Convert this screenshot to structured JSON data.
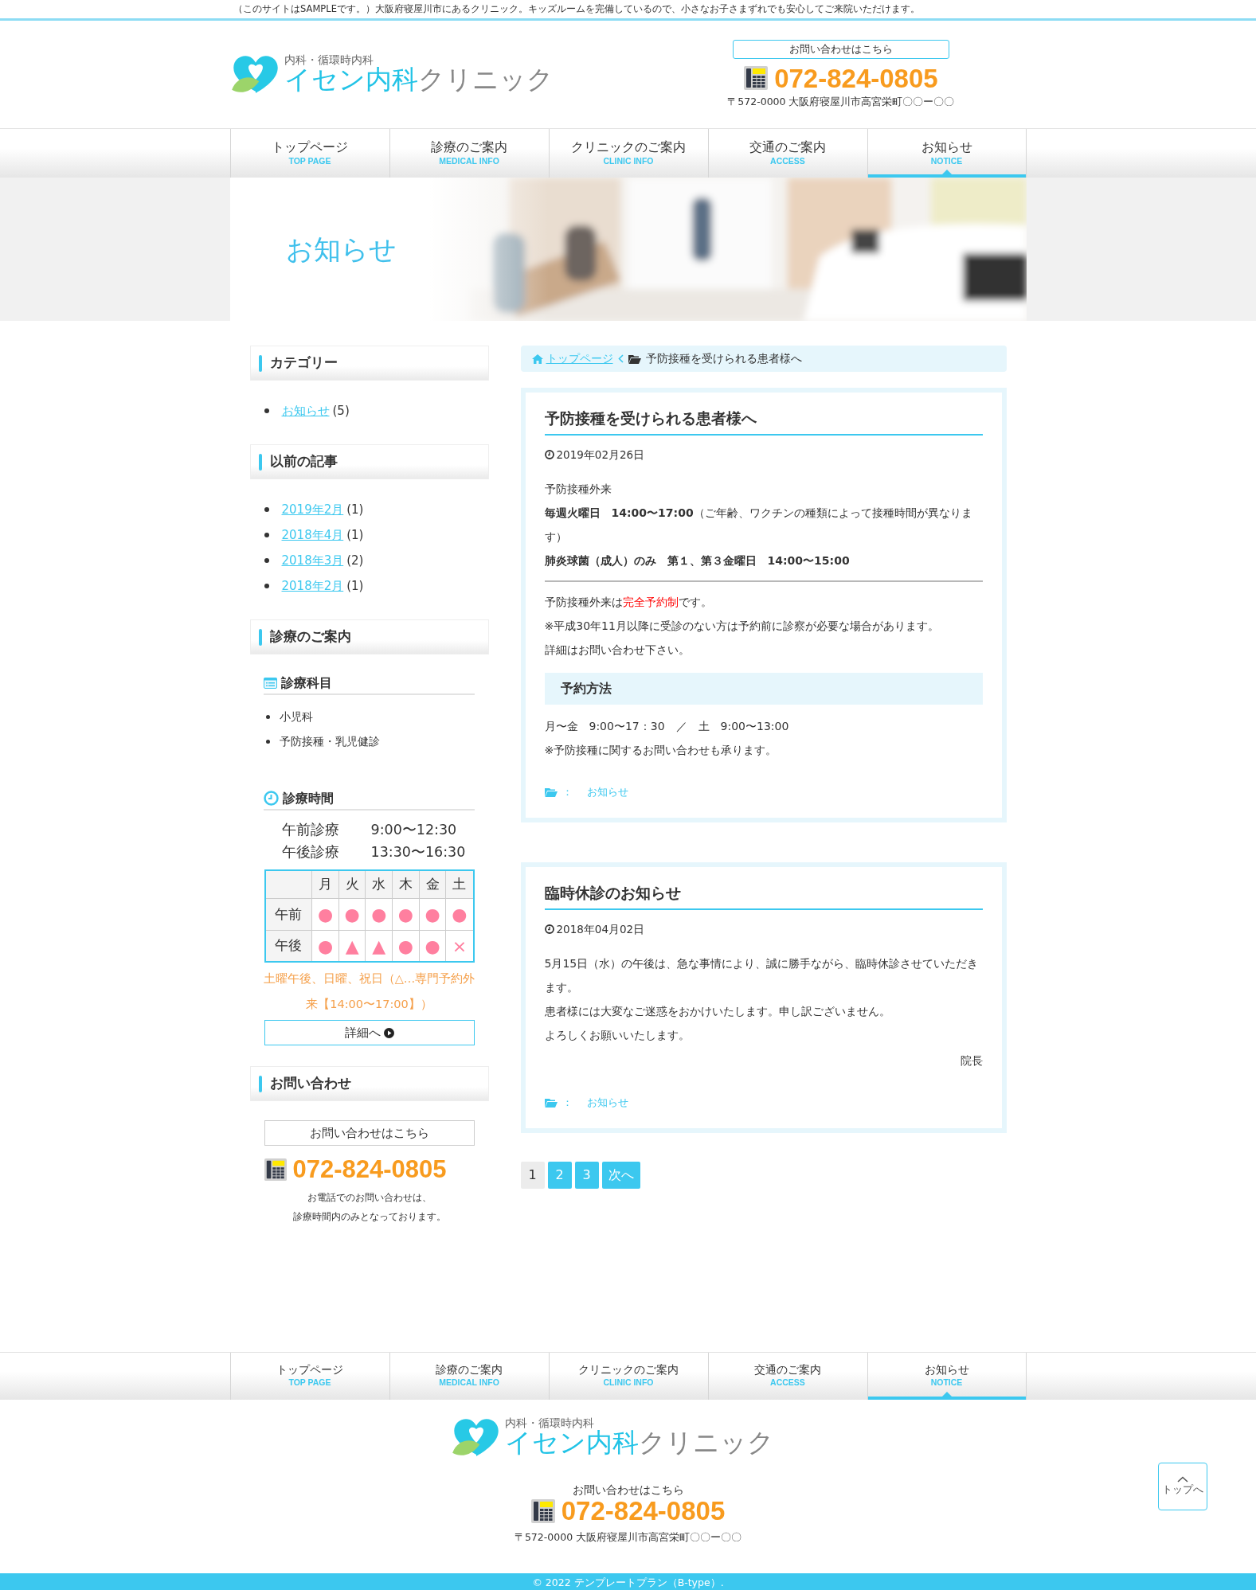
{
  "top_notice": "（このサイトはSAMPLEです。）大阪府寝屋川市にあるクリニック。キッズルームを完備しているので、小さなお子さまずれでも安心してご来院いただけます。",
  "header": {
    "logo": {
      "subtitle": "内科・循環時内科",
      "name_main": "イセン内科",
      "name_rest": "クリニック"
    },
    "contact": {
      "label": "お問い合わせはこちら",
      "phone": "072-824-0805",
      "address": "〒572-0000 大阪府寝屋川市高宮栄町〇〇ー〇〇"
    }
  },
  "nav": [
    {
      "label": "トップページ",
      "sublabel": "TOP PAGE",
      "selected": false
    },
    {
      "label": "診療のご案内",
      "sublabel": "MEDICAL INFO",
      "selected": false
    },
    {
      "label": "クリニックのご案内",
      "sublabel": "CLINIC INFO",
      "selected": false
    },
    {
      "label": "交通のご案内",
      "sublabel": "ACCESS",
      "selected": false
    },
    {
      "label": "お知らせ",
      "sublabel": "NOTICE",
      "selected": true
    }
  ],
  "hero": {
    "title": "お知らせ",
    "kind": "picture"
  },
  "sidebar": {
    "category": {
      "title": "カテゴリー",
      "items": [
        {
          "label": "お知らせ",
          "count": "(5)"
        }
      ]
    },
    "archive": {
      "title": "以前の記事",
      "items": [
        {
          "label": "2019年2月",
          "count": "(1)"
        },
        {
          "label": "2018年4月",
          "count": "(1)"
        },
        {
          "label": "2018年3月",
          "count": "(2)"
        },
        {
          "label": "2018年2月",
          "count": "(1)"
        }
      ]
    },
    "medical": {
      "title": "診療のご案内",
      "departments": {
        "title": "診療科目",
        "items": [
          "小児科",
          "予防接種・乳児健診"
        ]
      },
      "hours": {
        "title": "診療時間",
        "rows": [
          {
            "label": "午前診療",
            "time": "9:00〜12:30"
          },
          {
            "label": "午後診療",
            "time": "13:30〜16:30"
          }
        ],
        "days": [
          "月",
          "火",
          "水",
          "木",
          "金",
          "土"
        ],
        "schedule": [
          {
            "label": "午前",
            "marks": [
              "●",
              "●",
              "●",
              "●",
              "●",
              "●"
            ]
          },
          {
            "label": "午後",
            "marks": [
              "●",
              "▲",
              "▲",
              "●",
              "●",
              "×"
            ]
          }
        ],
        "note": "土曜午後、日曜、祝日（△…専門予約外来【14:00〜17:00】）",
        "button": "詳細へ"
      }
    },
    "contact": {
      "title": "お問い合わせ",
      "label": "お問い合わせはこちら",
      "phone": "072-824-0805",
      "note_lines": [
        "お電話でのお問い合わせは、",
        "診療時間内のみとなっております。"
      ]
    }
  },
  "breadcrumb": {
    "home": "トップページ",
    "current": "予防接種を受けられる患者様へ"
  },
  "posts": [
    {
      "title": "予防接種を受けられる患者様へ",
      "date": "2019年02月26日",
      "category_sep": "：",
      "category": "お知らせ",
      "body": [
        {
          "kind": "para",
          "text": "予防接種外来"
        },
        {
          "kind": "para",
          "text": "**毎週火曜日　14:00〜17:00**（ご年齢、ワクチンの種類によって接種時間が異なります）"
        },
        {
          "kind": "strong",
          "text": "肺炎球菌（成人）のみ　第１、第３金曜日　14:00〜15:00"
        },
        {
          "kind": "rule"
        },
        {
          "kind": "segments",
          "segments": [
            {
              "text": "予防接種外来は",
              "highlight": false
            },
            {
              "text": "完全予約制",
              "highlight": true
            },
            {
              "text": "です。",
              "highlight": false
            }
          ]
        },
        {
          "kind": "para",
          "text": "※平成30年11月以降に受診のない方は予約前に診察が必要な場合があります。"
        },
        {
          "kind": "para",
          "text": "詳細はお問い合わせ下さい。"
        },
        {
          "kind": "heading",
          "text": "予約方法"
        },
        {
          "kind": "para",
          "text": "月〜金　9:00〜17：30　／　土　9:00〜13:00"
        },
        {
          "kind": "para",
          "text": "※予防接種に関するお問い合わせも承ります。"
        }
      ]
    },
    {
      "title": "臨時休診のお知らせ",
      "date": "2018年04月02日",
      "category_sep": "：",
      "category": "お知らせ",
      "body": [
        {
          "kind": "para",
          "text": "5月15日（水）の午後は、急な事情により、誠に勝手ながら、臨時休診させていただきます。"
        },
        {
          "kind": "para",
          "text": "患者様には大変なご迷惑をおかけいたします。申し訳ございません。"
        },
        {
          "kind": "para",
          "text": "よろしくお願いいたします。"
        },
        {
          "kind": "signature",
          "text": "院長"
        }
      ]
    }
  ],
  "pagination": [
    {
      "label": "1",
      "selected": true
    },
    {
      "label": "2",
      "selected": false
    },
    {
      "label": "3",
      "selected": false
    },
    {
      "label": "次へ",
      "selected": false
    }
  ],
  "footer": {
    "nav": [
      {
        "label": "トップページ",
        "sublabel": "TOP PAGE",
        "selected": false
      },
      {
        "label": "診療のご案内",
        "sublabel": "MEDICAL INFO",
        "selected": false
      },
      {
        "label": "クリニックのご案内",
        "sublabel": "CLINIC INFO",
        "selected": false
      },
      {
        "label": "交通のご案内",
        "sublabel": "ACCESS",
        "selected": false
      },
      {
        "label": "お知らせ",
        "sublabel": "NOTICE",
        "selected": true
      }
    ],
    "logo": {
      "subtitle": "内科・循環時内科",
      "name_main": "イセン内科",
      "name_rest": "クリニック"
    },
    "contact_label": "お問い合わせはこちら",
    "phone": "072-824-0805",
    "address": "〒572-0000 大阪府寝屋川市高宮栄町〇〇ー〇〇",
    "back_to_top": "トップへ",
    "copyright": "© 2022 テンプレートプラン（B-type）."
  }
}
